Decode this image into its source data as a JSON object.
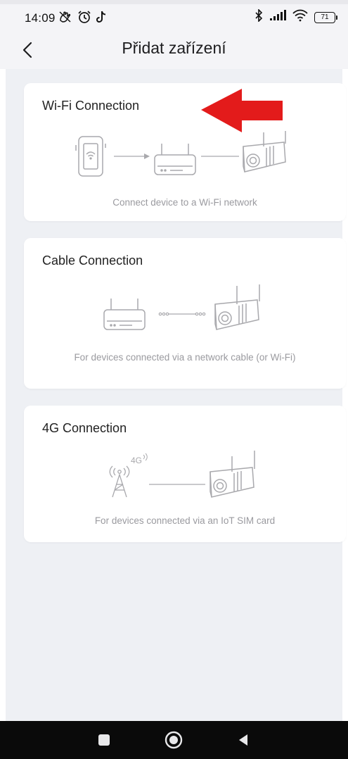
{
  "status_bar": {
    "time": "14:09",
    "battery": "71",
    "icons_left": [
      "hand-off-icon",
      "alarm-icon",
      "tiktok-icon"
    ],
    "icons_right": [
      "bluetooth-icon",
      "signal-icon",
      "wifi-icon",
      "battery-icon"
    ]
  },
  "header": {
    "title": "Přidat zařízení",
    "back_icon": "chevron-left-icon"
  },
  "cards": [
    {
      "title": "Wi-Fi Connection",
      "description": "Connect device to a Wi-Fi network",
      "icons": [
        "phone-wifi-icon",
        "router-icon",
        "camera-icon"
      ]
    },
    {
      "title": "Cable Connection",
      "description": "For devices connected via a network cable (or Wi-Fi)",
      "icons": [
        "router-icon",
        "camera-icon"
      ]
    },
    {
      "title": "4G Connection",
      "description": "For devices connected via an IoT SIM card",
      "icons": [
        "cell-tower-icon",
        "camera-icon"
      ],
      "badge": "4G"
    }
  ],
  "annotation": {
    "icon": "red-arrow-icon",
    "color": "#e31b1b"
  },
  "nav_bar": {
    "icons": [
      "recents-icon",
      "home-icon",
      "back-icon"
    ]
  },
  "colors": {
    "background": "#eef0f4",
    "card": "#ffffff",
    "text": "#222222",
    "muted_text": "#9a9a9f",
    "illustration_stroke": "#a9a9ad"
  }
}
